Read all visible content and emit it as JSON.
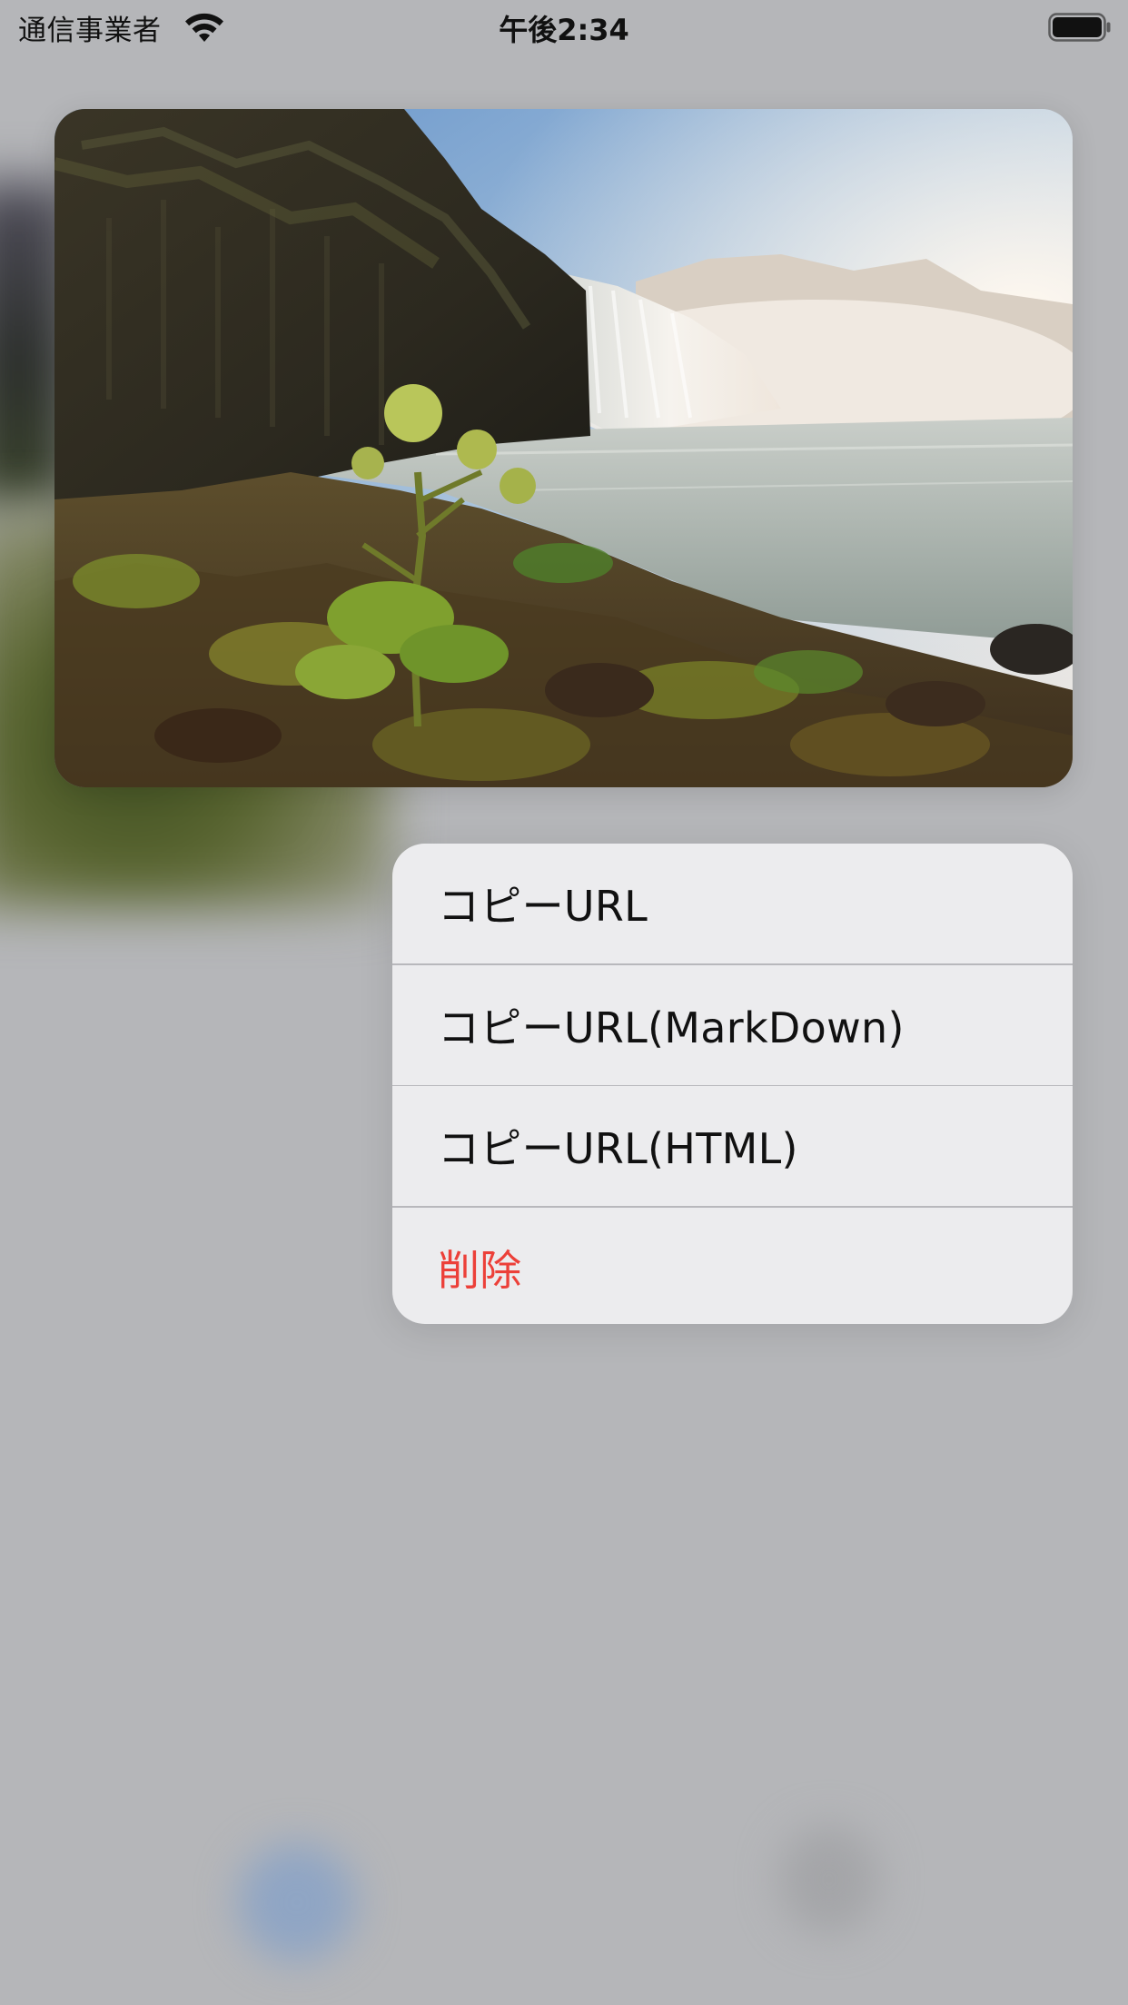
{
  "status_bar": {
    "carrier": "通信事業者",
    "time": "午後2:34",
    "wifi_icon": "wifi-icon",
    "battery_icon": "battery-icon"
  },
  "preview": {
    "image_icon": "waterfall-photo"
  },
  "context_menu": {
    "items": [
      {
        "label": "コピーURL"
      },
      {
        "label": "コピーURL(MarkDown)"
      },
      {
        "label": "コピーURL(HTML)"
      },
      {
        "label": "削除"
      }
    ],
    "destructive_color": "#ec4039"
  }
}
